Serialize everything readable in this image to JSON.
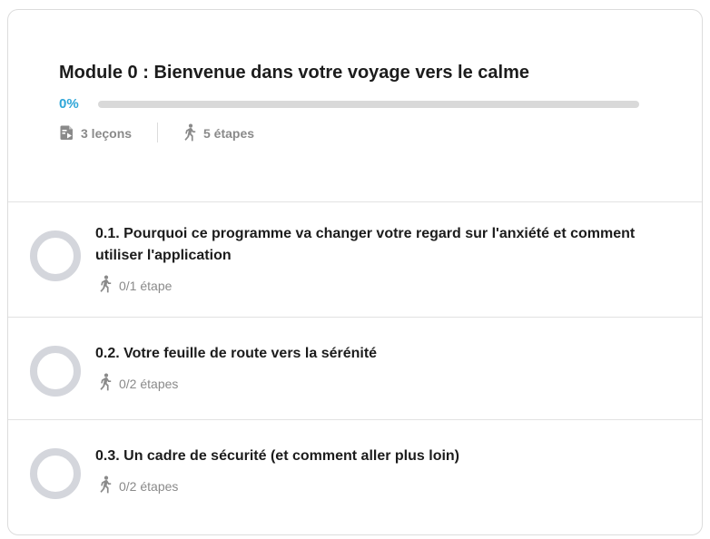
{
  "module": {
    "title": "Module 0 : Bienvenue dans votre voyage vers le calme",
    "progress_label": "0%",
    "progress_value": 0,
    "lessons_count": "3 leçons",
    "steps_count": "5 étapes",
    "lessons_icon": "document-play-icon",
    "steps_icon": "walking-person-icon"
  },
  "lessons": [
    {
      "title": "0.1. Pourquoi ce programme va changer votre regard sur l'anxiété et comment utiliser l'application",
      "steps": "0/1 étape"
    },
    {
      "title": "0.2. Votre feuille de route vers la sérénité",
      "steps": "0/2 étapes"
    },
    {
      "title": "0.3. Un cadre de sécurité (et comment aller plus loin)",
      "steps": "0/2 étapes"
    }
  ],
  "colors": {
    "accent": "#2ea6d8",
    "ring": "#d4d6dc",
    "track": "#d9d9d9",
    "muted_text": "#8a8a8a",
    "title_text": "#1c1c1c"
  }
}
